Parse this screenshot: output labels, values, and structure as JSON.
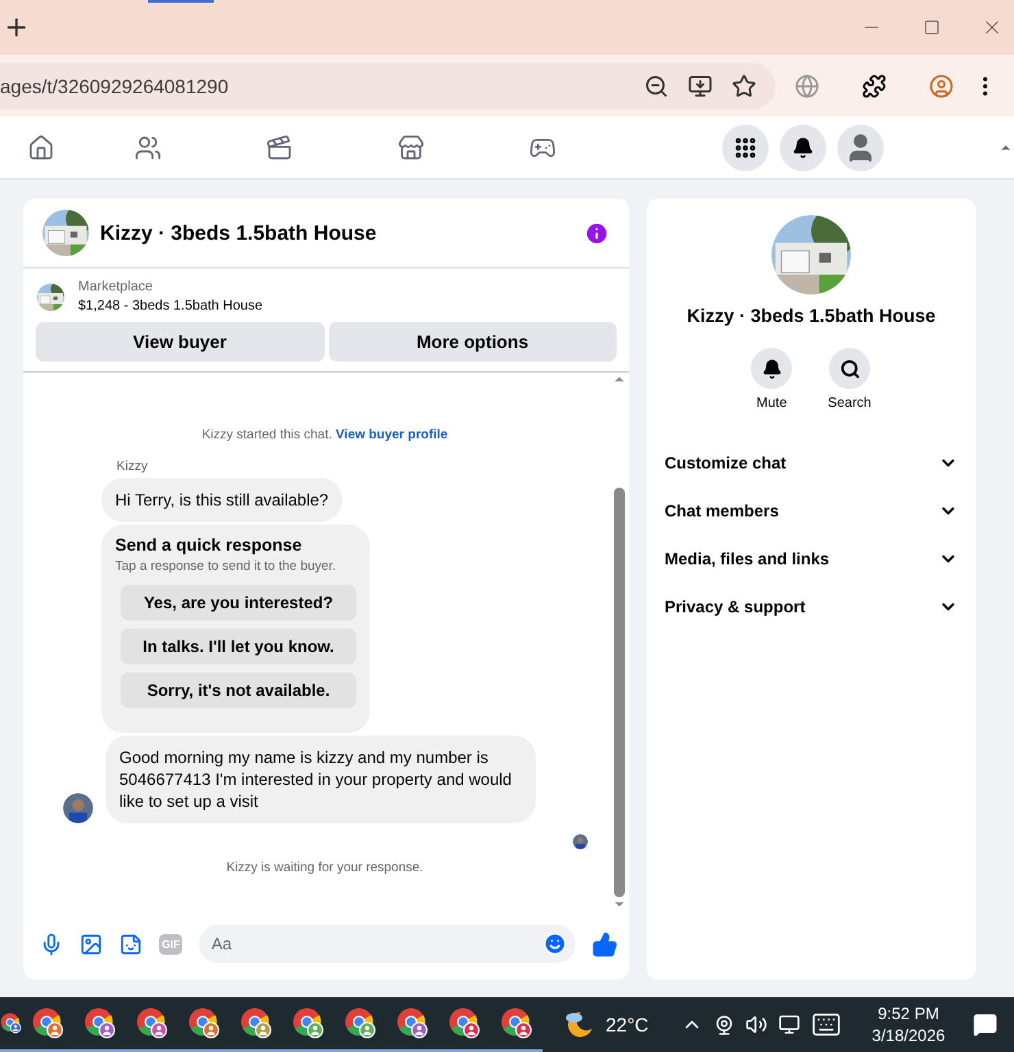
{
  "browser": {
    "url": "ages/t/3260929264081290"
  },
  "chat": {
    "title": "Kizzy · 3beds 1.5bath House",
    "listing": {
      "source": "Marketplace",
      "price_title": "$1,248 - 3beds 1.5bath House"
    },
    "actions": [
      "View buyer",
      "More options"
    ],
    "started_note": "Kizzy started this chat.",
    "profile_link": "View buyer profile",
    "sender": "Kizzy",
    "first_message": "Hi Terry, is this still available?",
    "quick": {
      "title": "Send a quick response",
      "hint": "Tap a response to send it to the buyer.",
      "responses": [
        "Yes, are you interested?",
        "In talks. I'll let you know.",
        "Sorry, it's not available."
      ]
    },
    "message": "Good morning my name is kizzy and my number is 5046677413 I'm interested in your property and would like to set up a visit",
    "waiting_note": "Kizzy is waiting for your response.",
    "composer": {
      "gif_label": "GIF",
      "placeholder": "Aa"
    }
  },
  "details": {
    "title": "Kizzy · 3beds 1.5bath House",
    "buttons": [
      {
        "kind": "bell",
        "label": "Mute"
      },
      {
        "kind": "search",
        "label": "Search"
      }
    ],
    "sections": [
      {
        "label": "Customize chat",
        "expanded": false
      },
      {
        "label": "Chat members",
        "expanded": false
      },
      {
        "label": "Media, files and links",
        "expanded": false
      },
      {
        "label": "Privacy & support",
        "expanded": false
      }
    ]
  },
  "taskbar": {
    "apps": [
      {
        "color": "#4466dd"
      },
      {
        "color": "#e07030"
      },
      {
        "color": "#a060d0"
      },
      {
        "color": "#d050b0"
      },
      {
        "color": "#e07030"
      },
      {
        "color": "#b0a050"
      },
      {
        "color": "#60b060"
      },
      {
        "color": "#60b060"
      },
      {
        "color": "#a060d0"
      },
      {
        "color": "#e03050"
      },
      {
        "color": "#e03050"
      }
    ],
    "temperature": "22°C",
    "time": "9:52 PM",
    "date": "3/18/2026"
  }
}
